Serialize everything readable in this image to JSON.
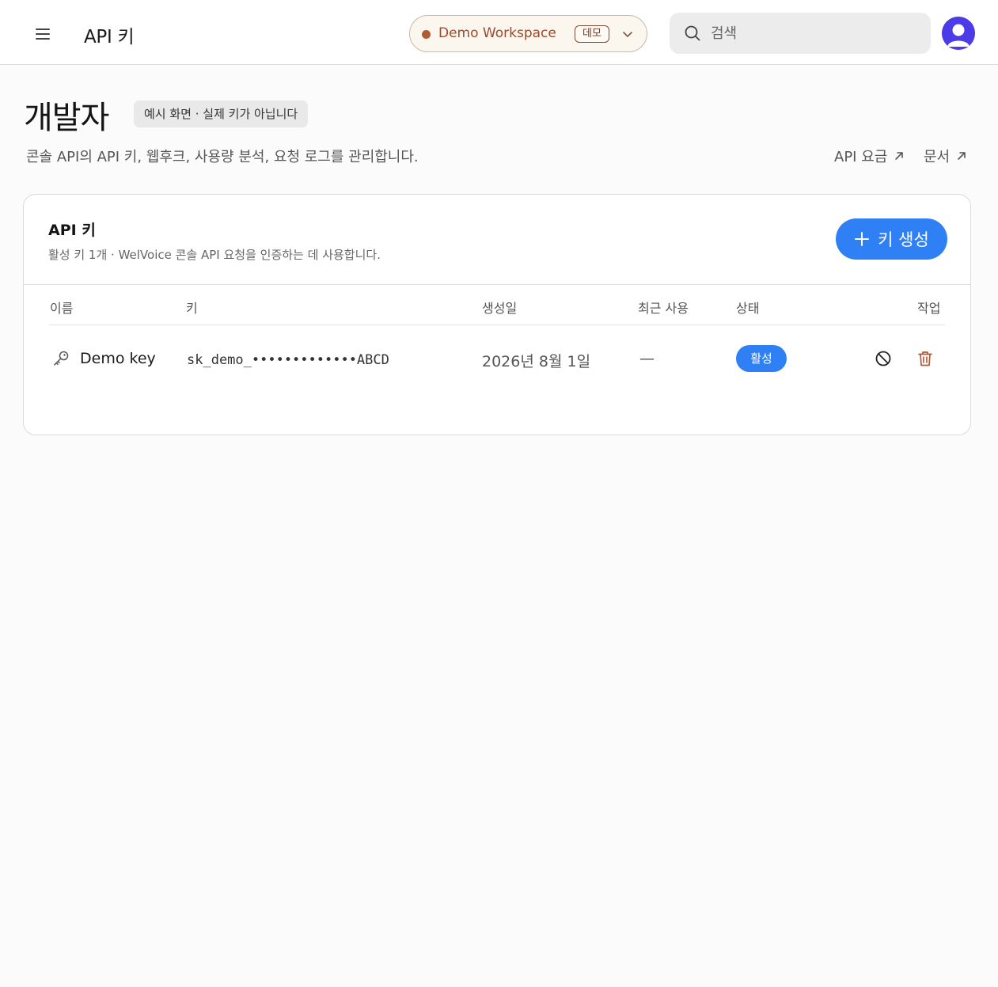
{
  "header": {
    "title": "API 키",
    "menu_icon": "hamburger-menu-icon",
    "workspace": {
      "name": "Demo Workspace",
      "badge": "데모",
      "status_color": "#b15a36"
    },
    "search": {
      "placeholder": "검색",
      "value": ""
    },
    "avatar_color": "#4b3ce8"
  },
  "page": {
    "title": "개발자",
    "demo_notice": "예시 화면 · 실제 키가 아닙니다",
    "description": "콘솔 API의 API 키, 웹후크, 사용량 분석, 요청 로그를 관리합니다.",
    "links": [
      {
        "label": "API 요금",
        "icon": "external-link-icon"
      },
      {
        "label": "문서",
        "icon": "external-link-icon"
      }
    ]
  },
  "card": {
    "title": "API 키",
    "subtitle": "활성 키 1개 · WelVoice 콘솔 API 요청을 인증하는 데 사용합니다.",
    "create_button": "키 생성",
    "columns": [
      "이름",
      "키",
      "생성일",
      "최근 사용",
      "상태",
      "작업"
    ],
    "rows": [
      {
        "name": "Demo key",
        "key": "sk_demo_•••••••••••••ABCD",
        "created": "2026년 8월 1일",
        "last_used": "—",
        "status": "활성",
        "actions": [
          "revoke-icon",
          "trash-icon"
        ]
      }
    ]
  },
  "colors": {
    "accent": "#2f7ff5",
    "workspace_text": "#9a4b2c",
    "delete": "#b15a36"
  }
}
